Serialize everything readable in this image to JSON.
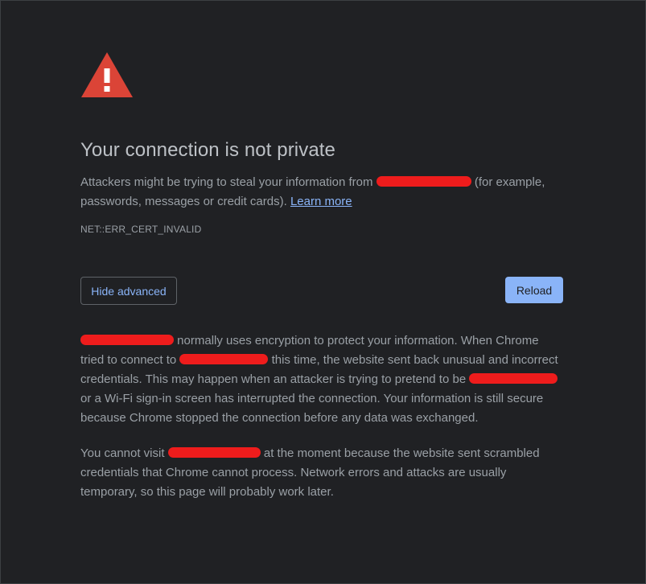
{
  "heading": "Your connection is not private",
  "intro": {
    "before": "Attackers might be trying to steal your information from",
    "after": "(for example, passwords, messages or credit cards).",
    "learn_more": "Learn more"
  },
  "error_code": "NET::ERR_CERT_INVALID",
  "buttons": {
    "hide_advanced": "Hide advanced",
    "reload": "Reload"
  },
  "details": {
    "p1_seg1": "normally uses encryption to protect your information. When Chrome tried to connect to",
    "p1_seg2": "this time, the website sent back unusual and incorrect credentials. This may happen when an attacker is trying to pretend to be",
    "p1_seg3": "or a Wi-Fi sign-in screen has interrupted the connection. Your information is still secure because Chrome stopped the connection before any data was exchanged.",
    "p2_seg1": "You cannot visit",
    "p2_seg2": "at the moment because the website sent scrambled credentials that Chrome cannot process. Network errors and attacks are usually temporary, so this page will probably work later."
  },
  "colors": {
    "background": "#202124",
    "heading": "#bdc1c6",
    "body_text": "#9aa0a6",
    "link": "#8ab4f8",
    "warning_red": "#db4437",
    "redaction": "#ee1c1c"
  },
  "icons": {
    "warning": "warning-triangle-icon"
  }
}
